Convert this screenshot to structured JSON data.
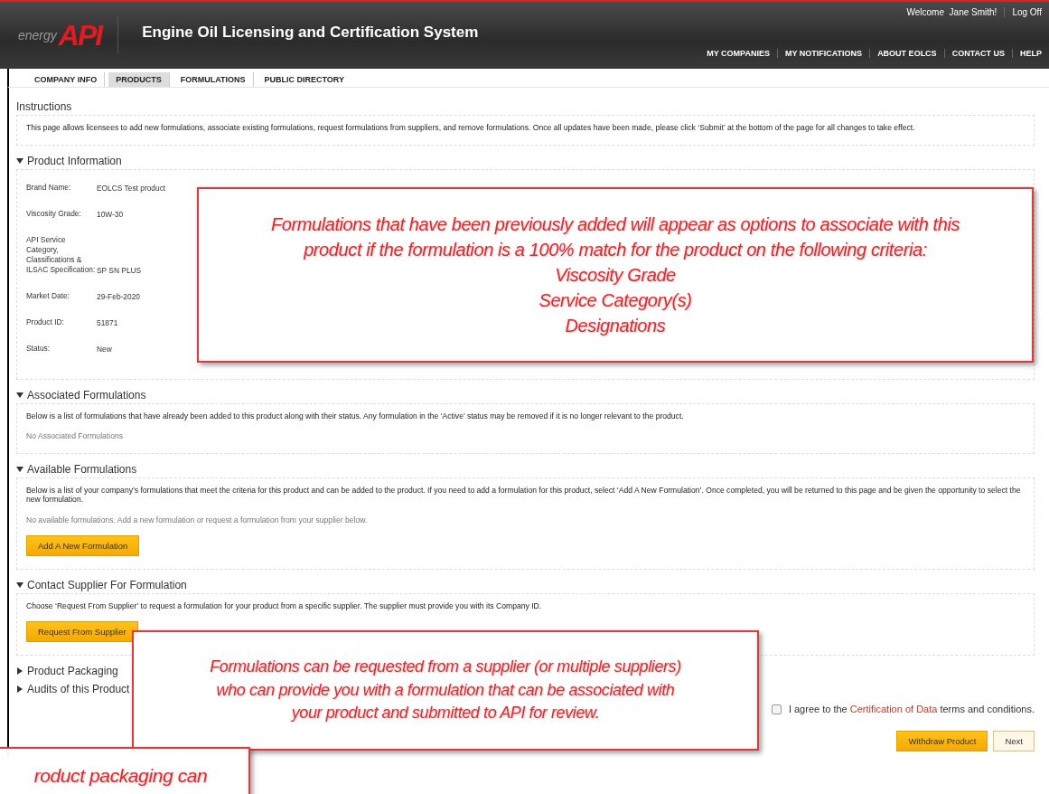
{
  "header": {
    "logo": {
      "tagline": "energy",
      "mark": "API"
    },
    "title": "Engine Oil Licensing and Certification System",
    "welcome": "Welcome  Jane Smith!",
    "logoff": "Log Off",
    "nav": [
      "MY COMPANIES",
      "MY NOTIFICATIONS",
      "ABOUT EOLCS",
      "CONTACT US",
      "HELP"
    ]
  },
  "tabs": [
    {
      "label": "COMPANY INFO",
      "selected": false
    },
    {
      "label": "PRODUCTS",
      "selected": true
    },
    {
      "label": "FORMULATIONS",
      "selected": false
    },
    {
      "label": "PUBLIC DIRECTORY",
      "selected": false
    }
  ],
  "sections": [
    {
      "kind": "panel",
      "title": "Instructions",
      "description": "This page allows licensees to add new formulations, associate existing formulations, request formulations from suppliers, and remove formulations. Once all updates have been made, please click ‘Submit’ at the bottom of the page for all changes to take effect."
    },
    {
      "kind": "fields",
      "title": "Product Information",
      "expanded": true,
      "fields": [
        {
          "label": "Brand Name:",
          "value": "EOLCS Test product"
        },
        {
          "label": "Viscosity Grade:",
          "value": "10W-30"
        },
        {
          "label": "API Service Category, Classifications & ILSAC Specification:",
          "value": "SP SN PLUS"
        },
        {
          "label": "Market Date:",
          "value": "29-Feb-2020"
        },
        {
          "label": "Product ID:",
          "value": "51871"
        },
        {
          "label": "Status:",
          "value": "New"
        }
      ]
    },
    {
      "kind": "panel",
      "title": "Associated Formulations",
      "expanded": true,
      "description": "Below is a list of formulations that have already been added to this product along with their status. Any formulation in the ‘Active’ status may be removed if it is no longer relevant to the product.",
      "note": "No Associated Formulations"
    },
    {
      "kind": "panel",
      "title": "Available Formulations",
      "expanded": true,
      "description": "Below is a list of your company’s formulations that meet the criteria for this product and can be added to the product. If you need to add a formulation for this product, select ‘Add A New Formulation’. Once completed, you will be returned to this page and be given the opportunity to select the new formulation.",
      "note": "No available formulations. Add a new formulation or request a formulation from your supplier below.",
      "button": "Add A New Formulation"
    },
    {
      "kind": "panel",
      "title": "Contact Supplier For Formulation",
      "expanded": true,
      "description": "Choose ‘Request From Supplier’ to request a formulation for your product from a specific supplier. The supplier must provide you with its Company ID.",
      "button": "Request From Supplier"
    },
    {
      "kind": "panel",
      "title": "Product Packaging",
      "expanded": false
    },
    {
      "kind": "panel",
      "title": "Audits of this Product",
      "expanded": false
    }
  ],
  "agreement": {
    "checked": false,
    "prefix": "I agree to the",
    "link": "Certification of Data",
    "suffix": "terms and conditions."
  },
  "buttons": [
    {
      "label": "Withdraw Product",
      "kind": "primary"
    },
    {
      "label": "Next",
      "kind": "secondary"
    }
  ],
  "callouts": [
    {
      "lines": [
        "Formulations that have been previously added will appear as options to associate with this",
        "product if the formulation is a 100% match for the product on the following criteria:",
        "Viscosity Grade",
        "Service Category(s)",
        "Designations"
      ]
    },
    {
      "lines": [
        "Formulations can be requested from a supplier (or multiple suppliers)",
        "who can provide you with a formulation that can be associated with",
        "your product and submitted to API for review."
      ]
    },
    {
      "lines": [
        "roduct packaging can"
      ]
    }
  ]
}
